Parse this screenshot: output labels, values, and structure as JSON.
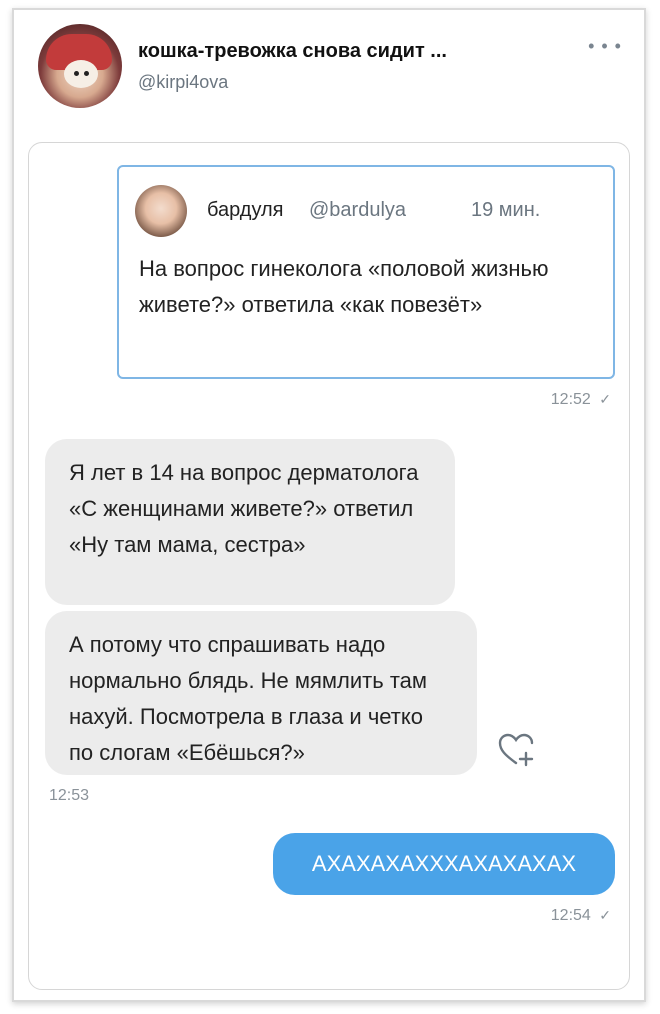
{
  "post": {
    "author_name": "кошка-тревожка снова сидит ...",
    "author_handle": "@kirpi4ova",
    "more_icon": "more-dots-icon"
  },
  "chat": {
    "quote": {
      "author": "бардуля",
      "handle": "@bardulya",
      "time": "19 мин.",
      "text": "На вопрос гинеколога «половой жизнью живете?» ответила «как повезёт»"
    },
    "quote_timestamp": "12:52",
    "messages": [
      {
        "text": "Я лет в 14 на вопрос дерматолога «С женщинами живете?» ответил «Ну там мама, сестра»"
      },
      {
        "text": "А потому что спрашивать надо нормально блядь. Не мямлить там нахуй. Посмотрела в глаза и четко по слогам «Ебёшься?»"
      }
    ],
    "incoming_timestamp": "12:53",
    "reply": {
      "text": "АХАХАХАХХХАХАХАХАХ",
      "timestamp": "12:54"
    },
    "reaction_icon": "heart-add-icon",
    "read_icon": "check-icon"
  }
}
